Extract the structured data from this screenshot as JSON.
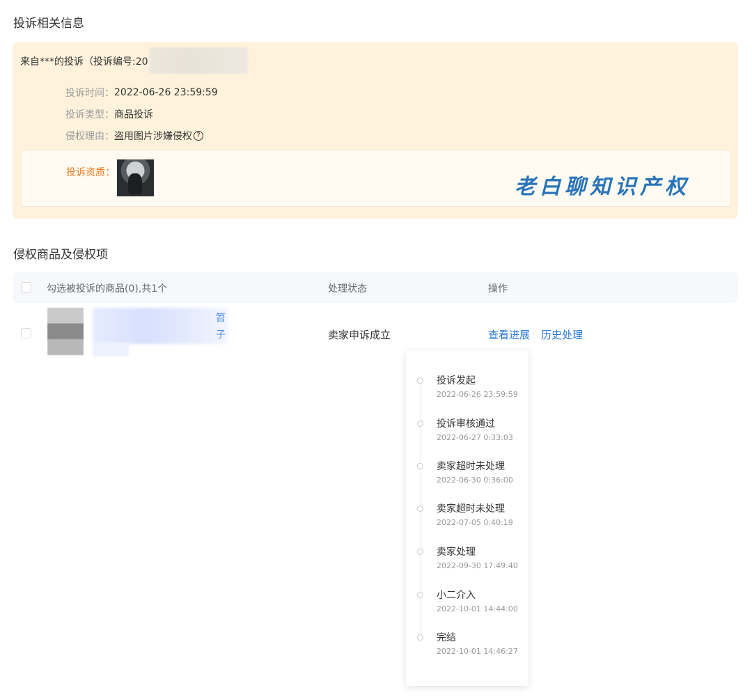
{
  "section1": {
    "title": "投诉相关信息",
    "header": "来自***的投诉（投诉编号:20",
    "rows": [
      {
        "label": "投诉时间：",
        "value": "2022-06-26 23:59:59"
      },
      {
        "label": "投诉类型：",
        "value": "商品投诉"
      },
      {
        "label": "侵权理由：",
        "value": "盗用图片涉嫌侵权"
      }
    ],
    "qualification_label": "投诉资质：",
    "watermark": "老白聊知识产权"
  },
  "section2": {
    "title": "侵权商品及侵权项",
    "table": {
      "headers": {
        "product": "勾选被投诉的商品(0),共1个",
        "status": "处理状态",
        "actions": "操作"
      },
      "row": {
        "link_char_1": "笤",
        "link_char_2": "子",
        "status": "卖家申诉成立",
        "view_progress": "查看进展",
        "history": "历史处理"
      }
    }
  },
  "progress": {
    "steps": [
      {
        "name": "投诉发起",
        "time": "2022-06-26 23:59:59"
      },
      {
        "name": "投诉审核通过",
        "time": "2022-06-27 0:33:03"
      },
      {
        "name": "卖家超时未处理",
        "time": "2022-06-30 0:36:00"
      },
      {
        "name": "卖家超时未处理",
        "time": "2022-07-05 0:40:19"
      },
      {
        "name": "卖家处理",
        "time": "2022-09-30 17:49:40"
      },
      {
        "name": "小二介入",
        "time": "2022-10-01 14:44:00"
      },
      {
        "name": "完结",
        "time": "2022-10-01 14:46:27"
      }
    ]
  },
  "colors": {
    "panel_bg": "#fff2dc",
    "accent_orange": "#f07a22",
    "link_blue": "#2b79d6"
  },
  "icons": [
    "help-circle-icon",
    "checkbox-icon",
    "timeline-dot-icon"
  ]
}
